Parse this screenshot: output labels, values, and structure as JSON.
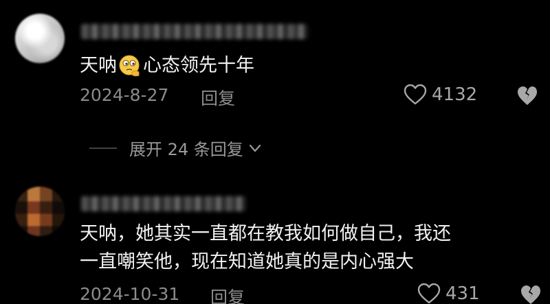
{
  "comments": [
    {
      "text_before_emoji": "天呐",
      "emoji": "thinking-face-emoji",
      "text_after_emoji": "心态领先十年",
      "date": "2024-8-27",
      "reply_label": "回复",
      "like_count": "4132"
    },
    {
      "text_line_1": "天呐，她其实一直都在教我如何做自己，我还",
      "text_line_2": "一直嘲笑他，现在知道她真的是内心强大",
      "date": "2024-10-31",
      "reply_label": "回复",
      "like_count": "431"
    }
  ],
  "expand_replies": {
    "label": "展开 24 条回复"
  },
  "colors": {
    "background": "#000000",
    "text": "#f2f2f2",
    "meta": "#8c8c8c",
    "icon": "#a8a8a8"
  }
}
